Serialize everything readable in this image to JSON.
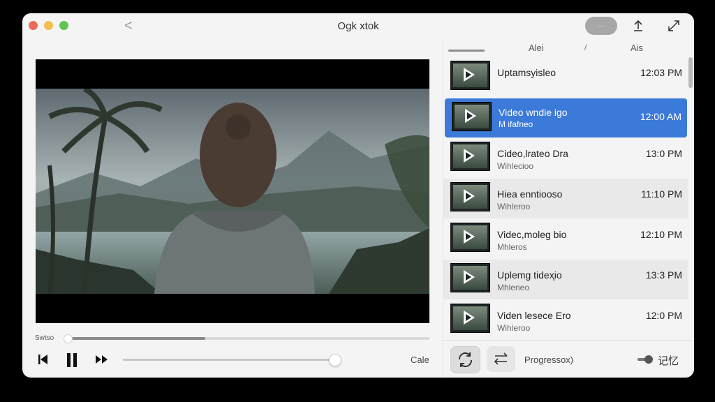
{
  "window": {
    "title": "Ogk xtok",
    "pill_label": "···",
    "nav_back": "<"
  },
  "player": {
    "scrub_label": "Swtso",
    "scrub_progress": 0.38,
    "volume_level": 0.99,
    "right_label": "Cale"
  },
  "icons": {
    "toolbar": [
      "share-icon",
      "expand-icon"
    ],
    "controls": [
      "previous-icon",
      "pause-icon",
      "next-icon"
    ],
    "footer": [
      "sync-icon",
      "swap-icon"
    ]
  },
  "sidebar": {
    "columns": [
      "Alei",
      "/",
      "Ais"
    ],
    "items": [
      {
        "title": "Uptamsyisleo",
        "subtitle": "",
        "time": "12:03 PM"
      },
      {
        "title": "Video wndie igo",
        "subtitle": "M ifafneo",
        "time": "12:00 AM"
      },
      {
        "title": "Cideo,lrateo Dra",
        "subtitle": "Wihlecioo",
        "time": "13:0 PM"
      },
      {
        "title": "Hiea enntiooso",
        "subtitle": "Wihleroo",
        "time": "11:10 PM"
      },
      {
        "title": "Videc,moleg bio",
        "subtitle": "Mhleros",
        "time": "12:10 PM"
      },
      {
        "title": "Uplemg tideҳio",
        "subtitle": "Mhleneo",
        "time": "13:3 PM"
      },
      {
        "title": "Viden lesece Ero",
        "subtitle": "Wihleroo",
        "time": "12:0 PM"
      }
    ],
    "selected_index": 1,
    "footer": {
      "label": "Progressox)",
      "toggle_label": "记忆"
    }
  },
  "colors": {
    "accent": "#3b7ad9",
    "window_bg": "#f4f4f4"
  }
}
